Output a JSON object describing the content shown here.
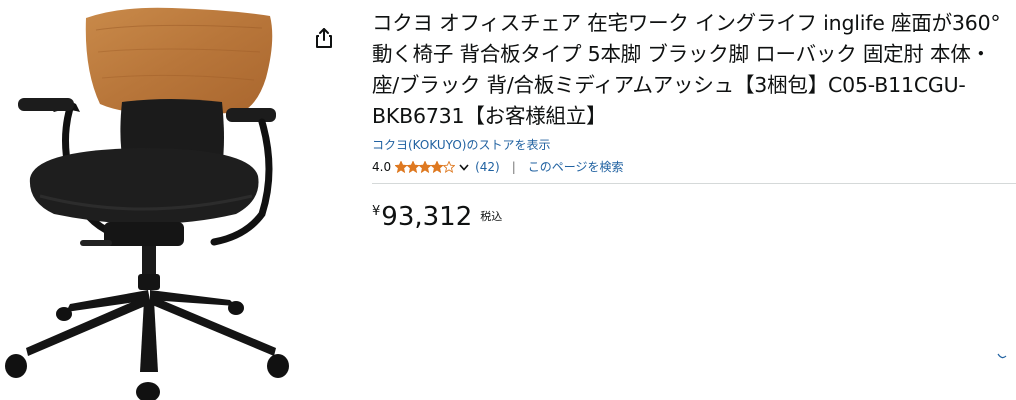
{
  "product": {
    "title": "コクヨ オフィスチェア 在宅ワーク イングライフ inglife 座面が360°動く椅子 背合板タイプ 5本脚 ブラック脚 ローバック 固定肘 本体・座/ブラック 背/合板ミディアムアッシュ【3梱包】C05-B11CGU-BKB6731【お客様組立】",
    "store_link": "コクヨ(KOKUYO)のストアを表示",
    "image_alt": "オフィスチェア"
  },
  "rating": {
    "value": "4.0",
    "stars_out_of_5": 4.0,
    "count": "(42)",
    "separator": "|",
    "search_link": "このページを検索"
  },
  "price": {
    "symbol": "¥",
    "whole": "93,312",
    "tax_note": "税込"
  },
  "colors": {
    "link": "#2162a1",
    "star": "#de7921",
    "text": "#0f1111",
    "divider": "#d5d9d9"
  },
  "icons": {
    "share": "share-icon",
    "star": "star-icon",
    "chevron": "chevron-down-icon"
  }
}
